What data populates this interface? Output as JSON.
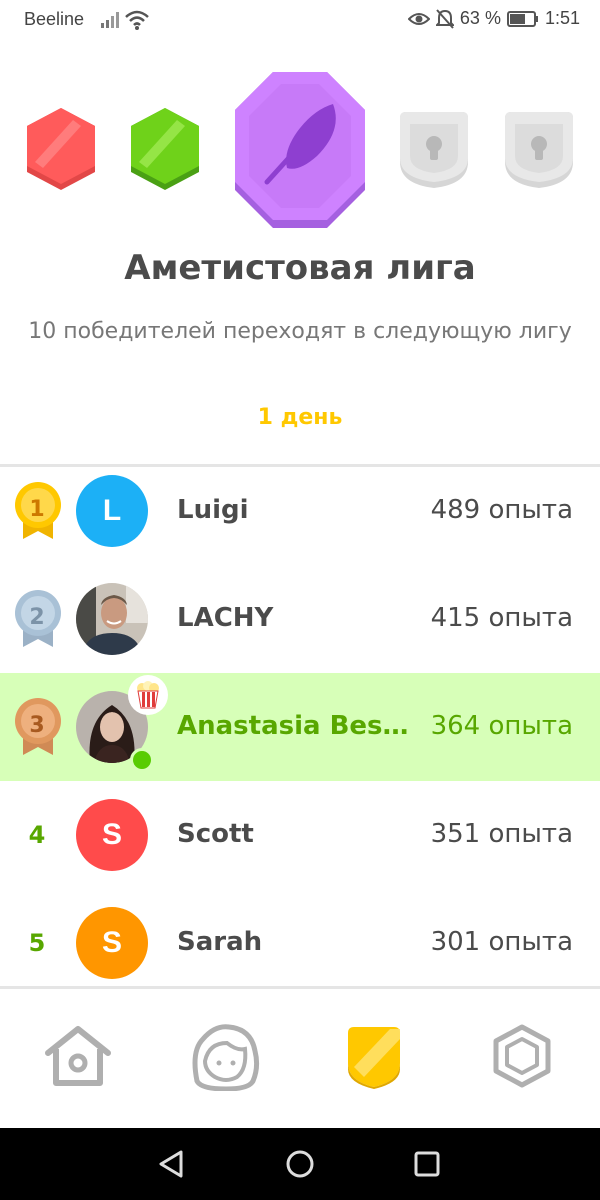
{
  "status_bar": {
    "carrier": "Beeline",
    "battery": "63 %",
    "time": "1:51"
  },
  "league": {
    "title": "Аметистовая лига",
    "description": "10 победителей переходят в следующую лигу",
    "timer": "1 день",
    "badges": [
      "ruby-league-badge",
      "emerald-league-badge",
      "amethyst-league-badge",
      "locked-league-badge",
      "locked-league-badge"
    ]
  },
  "leaderboard": [
    {
      "rank": "1",
      "name": "Luigi",
      "xp": "489 опыта",
      "avatar_letter": "L",
      "avatar_color": "#1cb0f6",
      "medal": "gold"
    },
    {
      "rank": "2",
      "name": "LACHY",
      "xp": "415 опыта",
      "avatar_letter": "",
      "avatar_color": "#7a8b9a",
      "medal": "silver"
    },
    {
      "rank": "3",
      "name": "Anastasia Bes…",
      "xp": "364 опыта",
      "avatar_letter": "",
      "avatar_color": "#4a3a3a",
      "medal": "bronze",
      "current_user": true
    },
    {
      "rank": "4",
      "name": "Scott",
      "xp": "351 опыта",
      "avatar_letter": "S",
      "avatar_color": "#ff4b4b"
    },
    {
      "rank": "5",
      "name": "Sarah",
      "xp": "301 опыта",
      "avatar_letter": "S",
      "avatar_color": "#ff9600"
    }
  ],
  "bottom_nav": [
    "home-icon",
    "profile-icon",
    "leagues-icon",
    "shop-icon"
  ],
  "colors": {
    "accent_green": "#58a700",
    "highlight": "#d7ffb8",
    "timer_yellow": "#ffc800",
    "amethyst": "#ce82ff"
  }
}
